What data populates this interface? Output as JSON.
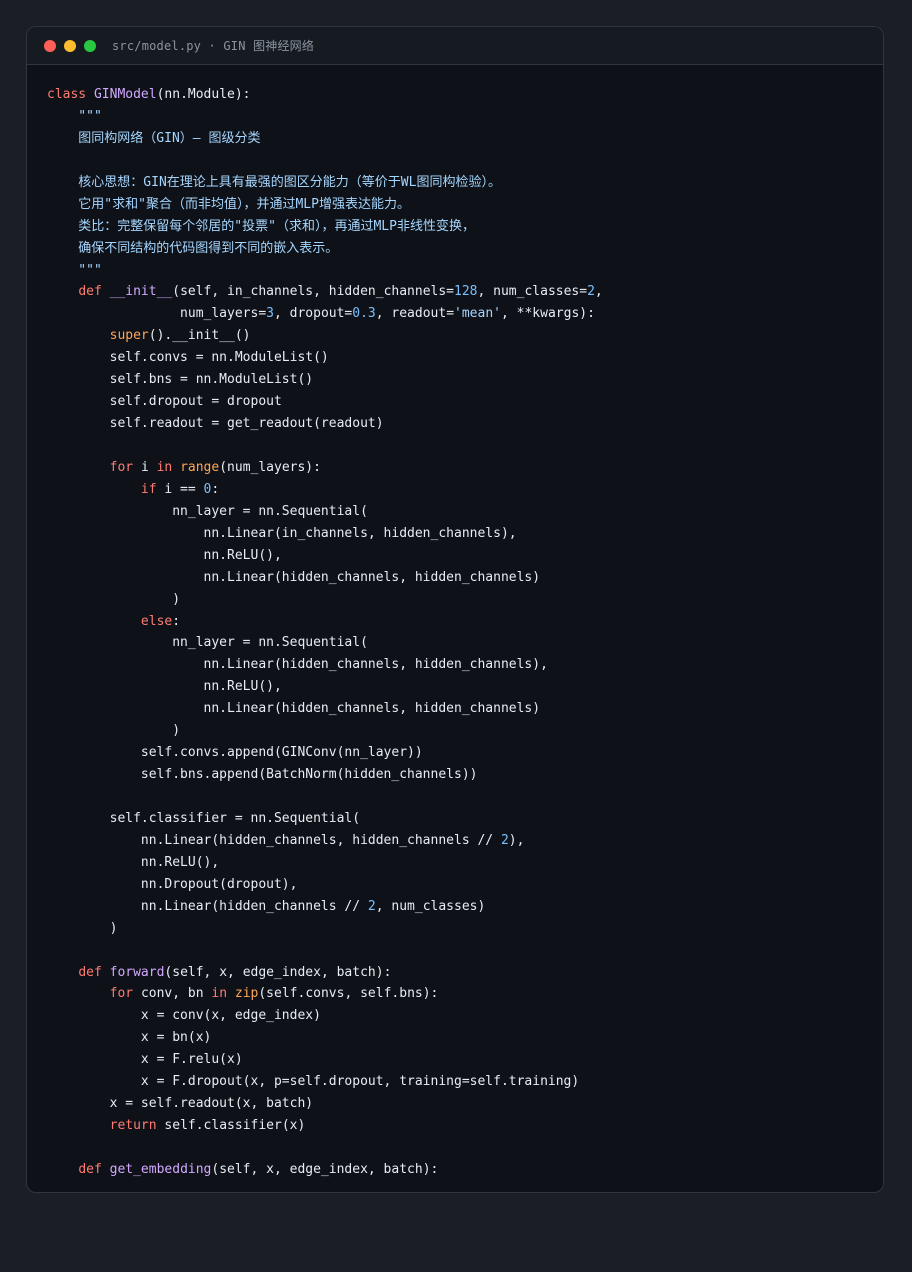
{
  "window": {
    "title": "src/model.py · GIN 图神经网络",
    "traffic_lights": [
      "close",
      "minimize",
      "maximize"
    ]
  },
  "code_lines": [
    [
      {
        "t": "class ",
        "c": "kw"
      },
      {
        "t": "GINModel",
        "c": "def"
      },
      {
        "t": "(nn.Module):",
        "c": "plain"
      }
    ],
    [
      {
        "t": "    \"\"\"",
        "c": "doc"
      }
    ],
    [
      {
        "t": "    图同构网络（GIN）— 图级分类",
        "c": "doc"
      }
    ],
    [],
    [
      {
        "t": "    核心思想：GIN在理论上具有最强的图区分能力（等价于WL图同构检验）。",
        "c": "doc"
      }
    ],
    [
      {
        "t": "    它用\"求和\"聚合（而非均值），并通过MLP增强表达能力。",
        "c": "doc"
      }
    ],
    [
      {
        "t": "    类比：完整保留每个邻居的\"投票\"（求和），再通过MLP非线性变换，",
        "c": "doc"
      }
    ],
    [
      {
        "t": "    确保不同结构的代码图得到不同的嵌入表示。",
        "c": "doc"
      }
    ],
    [
      {
        "t": "    \"\"\"",
        "c": "doc"
      }
    ],
    [
      {
        "t": "    ",
        "c": "plain"
      },
      {
        "t": "def ",
        "c": "kw"
      },
      {
        "t": "__init__",
        "c": "def"
      },
      {
        "t": "(self, in_channels, hidden_channels=",
        "c": "plain"
      },
      {
        "t": "128",
        "c": "num"
      },
      {
        "t": ", num_classes=",
        "c": "plain"
      },
      {
        "t": "2",
        "c": "num"
      },
      {
        "t": ",",
        "c": "plain"
      }
    ],
    [
      {
        "t": "                 num_layers=",
        "c": "plain"
      },
      {
        "t": "3",
        "c": "num"
      },
      {
        "t": ", dropout=",
        "c": "plain"
      },
      {
        "t": "0.3",
        "c": "num"
      },
      {
        "t": ", readout=",
        "c": "plain"
      },
      {
        "t": "'mean'",
        "c": "str"
      },
      {
        "t": ", **kwargs):",
        "c": "plain"
      }
    ],
    [
      {
        "t": "        ",
        "c": "plain"
      },
      {
        "t": "super",
        "c": "builtin"
      },
      {
        "t": "().__init__()",
        "c": "plain"
      }
    ],
    [
      {
        "t": "        self.convs = nn.ModuleList()",
        "c": "plain"
      }
    ],
    [
      {
        "t": "        self.bns = nn.ModuleList()",
        "c": "plain"
      }
    ],
    [
      {
        "t": "        self.dropout = dropout",
        "c": "plain"
      }
    ],
    [
      {
        "t": "        self.readout = get_readout(readout)",
        "c": "plain"
      }
    ],
    [],
    [
      {
        "t": "        ",
        "c": "plain"
      },
      {
        "t": "for ",
        "c": "kw"
      },
      {
        "t": "i ",
        "c": "plain"
      },
      {
        "t": "in ",
        "c": "kw"
      },
      {
        "t": "range",
        "c": "builtin"
      },
      {
        "t": "(num_layers):",
        "c": "plain"
      }
    ],
    [
      {
        "t": "            ",
        "c": "plain"
      },
      {
        "t": "if ",
        "c": "kw"
      },
      {
        "t": "i == ",
        "c": "plain"
      },
      {
        "t": "0",
        "c": "num"
      },
      {
        "t": ":",
        "c": "plain"
      }
    ],
    [
      {
        "t": "                nn_layer = nn.Sequential(",
        "c": "plain"
      }
    ],
    [
      {
        "t": "                    nn.Linear(in_channels, hidden_channels),",
        "c": "plain"
      }
    ],
    [
      {
        "t": "                    nn.ReLU(),",
        "c": "plain"
      }
    ],
    [
      {
        "t": "                    nn.Linear(hidden_channels, hidden_channels)",
        "c": "plain"
      }
    ],
    [
      {
        "t": "                )",
        "c": "plain"
      }
    ],
    [
      {
        "t": "            ",
        "c": "plain"
      },
      {
        "t": "else",
        "c": "kw"
      },
      {
        "t": ":",
        "c": "plain"
      }
    ],
    [
      {
        "t": "                nn_layer = nn.Sequential(",
        "c": "plain"
      }
    ],
    [
      {
        "t": "                    nn.Linear(hidden_channels, hidden_channels),",
        "c": "plain"
      }
    ],
    [
      {
        "t": "                    nn.ReLU(),",
        "c": "plain"
      }
    ],
    [
      {
        "t": "                    nn.Linear(hidden_channels, hidden_channels)",
        "c": "plain"
      }
    ],
    [
      {
        "t": "                )",
        "c": "plain"
      }
    ],
    [
      {
        "t": "            self.convs.append(GINConv(nn_layer))",
        "c": "plain"
      }
    ],
    [
      {
        "t": "            self.bns.append(BatchNorm(hidden_channels))",
        "c": "plain"
      }
    ],
    [],
    [
      {
        "t": "        self.classifier = nn.Sequential(",
        "c": "plain"
      }
    ],
    [
      {
        "t": "            nn.Linear(hidden_channels, hidden_channels // ",
        "c": "plain"
      },
      {
        "t": "2",
        "c": "num"
      },
      {
        "t": "),",
        "c": "plain"
      }
    ],
    [
      {
        "t": "            nn.ReLU(),",
        "c": "plain"
      }
    ],
    [
      {
        "t": "            nn.Dropout(dropout),",
        "c": "plain"
      }
    ],
    [
      {
        "t": "            nn.Linear(hidden_channels // ",
        "c": "plain"
      },
      {
        "t": "2",
        "c": "num"
      },
      {
        "t": ", num_classes)",
        "c": "plain"
      }
    ],
    [
      {
        "t": "        )",
        "c": "plain"
      }
    ],
    [],
    [
      {
        "t": "    ",
        "c": "plain"
      },
      {
        "t": "def ",
        "c": "kw"
      },
      {
        "t": "forward",
        "c": "def"
      },
      {
        "t": "(self, x, edge_index, batch):",
        "c": "plain"
      }
    ],
    [
      {
        "t": "        ",
        "c": "plain"
      },
      {
        "t": "for ",
        "c": "kw"
      },
      {
        "t": "conv, bn ",
        "c": "plain"
      },
      {
        "t": "in ",
        "c": "kw"
      },
      {
        "t": "zip",
        "c": "builtin"
      },
      {
        "t": "(self.convs, self.bns):",
        "c": "plain"
      }
    ],
    [
      {
        "t": "            x = conv(x, edge_index)",
        "c": "plain"
      }
    ],
    [
      {
        "t": "            x = bn(x)",
        "c": "plain"
      }
    ],
    [
      {
        "t": "            x = F.relu(x)",
        "c": "plain"
      }
    ],
    [
      {
        "t": "            x = F.dropout(x, p=self.dropout, training=self.training)",
        "c": "plain"
      }
    ],
    [
      {
        "t": "        x = self.readout(x, batch)",
        "c": "plain"
      }
    ],
    [
      {
        "t": "        ",
        "c": "plain"
      },
      {
        "t": "return ",
        "c": "kw"
      },
      {
        "t": "self.classifier(x)",
        "c": "plain"
      }
    ],
    [],
    [
      {
        "t": "    ",
        "c": "plain"
      },
      {
        "t": "def ",
        "c": "kw"
      },
      {
        "t": "get_embedding",
        "c": "def"
      },
      {
        "t": "(self, x, edge_index, batch):",
        "c": "plain"
      }
    ]
  ],
  "colors": {
    "page_background": "#1b1e26",
    "editor_background": "#0e1117",
    "titlebar_background": "#161b22",
    "keyword": "#ff7b72",
    "definition": "#d2a8ff",
    "builtin": "#ffa657",
    "number": "#79c0ff",
    "string": "#a5d6ff",
    "text": "#e6edf3"
  }
}
